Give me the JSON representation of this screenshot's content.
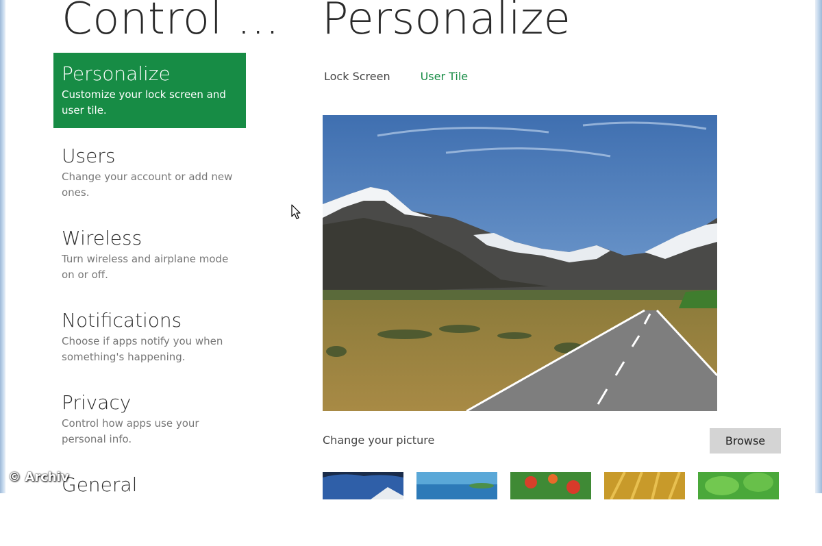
{
  "app": {
    "title": "Control ..."
  },
  "page": {
    "title": "Personalize"
  },
  "nav": {
    "items": [
      {
        "title": "Personalize",
        "desc": "Customize your lock screen and user tile."
      },
      {
        "title": "Users",
        "desc": "Change your account or add new ones."
      },
      {
        "title": "Wireless",
        "desc": "Turn wireless and airplane mode on or off."
      },
      {
        "title": "Notifications",
        "desc": "Choose if apps notify you when something's happening."
      },
      {
        "title": "Privacy",
        "desc": "Control how apps use your personal info."
      },
      {
        "title": "General",
        "desc": ""
      }
    ],
    "selected_index": 0
  },
  "tabs": [
    {
      "label": "Lock Screen",
      "active": false
    },
    {
      "label": "User Tile",
      "active": true
    }
  ],
  "picture": {
    "subject": "mountain-road-landscape"
  },
  "change_picture": {
    "label": "Change your picture",
    "browse_label": "Browse"
  },
  "thumbnails": [
    "mountain-thumb",
    "coast-thumb",
    "flowers-thumb",
    "wheat-thumb",
    "leaves-thumb"
  ],
  "watermark": {
    "text": "© Archiv"
  },
  "colors": {
    "accent": "#178c45",
    "button": "#d4d4d4"
  }
}
